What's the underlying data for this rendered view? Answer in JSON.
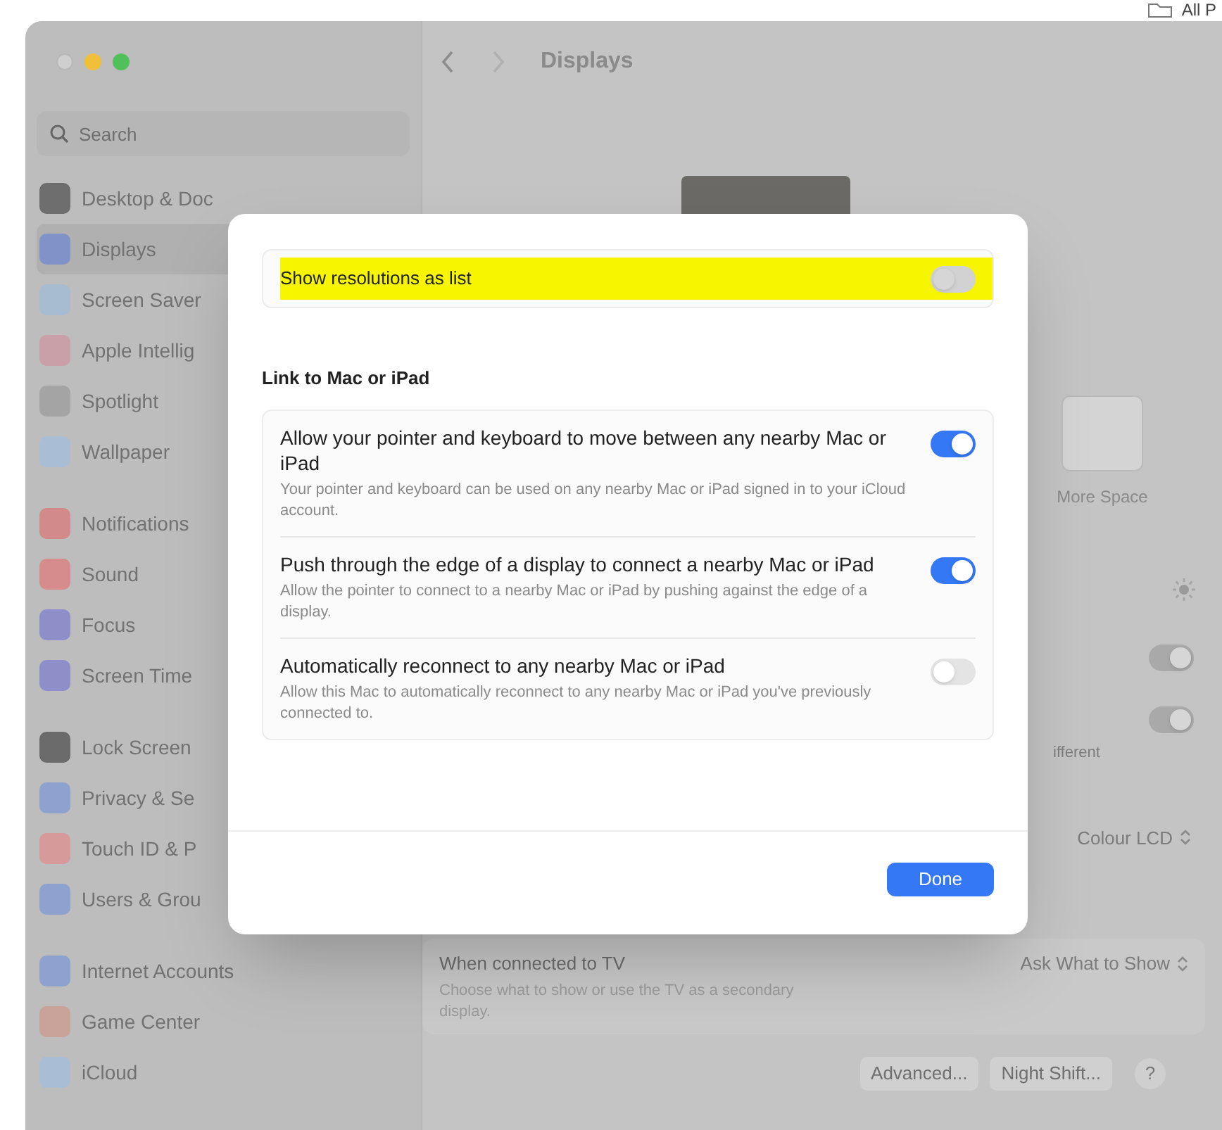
{
  "window": {
    "title": "Displays"
  },
  "top_right_label": "All P",
  "sidebar": {
    "search": {
      "placeholder": "Search"
    },
    "groups": [
      [
        {
          "label": "Desktop & Doc",
          "color": "#6e6e6e",
          "selected": false
        },
        {
          "label": "Displays",
          "color": "#7f93c8",
          "selected": true
        },
        {
          "label": "Screen Saver",
          "color": "#a7bcd0",
          "selected": false
        },
        {
          "label": "Apple Intellig",
          "color": "#c9a0a8",
          "selected": false
        },
        {
          "label": "Spotlight",
          "color": "#a4a4a4",
          "selected": false
        },
        {
          "label": "Wallpaper",
          "color": "#a9bdd4",
          "selected": false
        }
      ],
      [
        {
          "label": "Notifications",
          "color": "#d38a8a",
          "selected": false
        },
        {
          "label": "Sound",
          "color": "#d68c8c",
          "selected": false
        },
        {
          "label": "Focus",
          "color": "#8e8fc8",
          "selected": false
        },
        {
          "label": "Screen Time",
          "color": "#8e8fc8",
          "selected": false
        }
      ],
      [
        {
          "label": "Lock Screen",
          "color": "#6b6b6b",
          "selected": false
        },
        {
          "label": "Privacy & Se",
          "color": "#8ea2cf",
          "selected": false
        },
        {
          "label": "Touch ID & P",
          "color": "#d69a9a",
          "selected": false
        },
        {
          "label": "Users & Grou",
          "color": "#8ea2cf",
          "selected": false
        }
      ],
      [
        {
          "label": "Internet Accounts",
          "color": "#8ea2cf",
          "selected": false
        },
        {
          "label": "Game Center",
          "color": "#c9a39a",
          "selected": false
        },
        {
          "label": "iCloud",
          "color": "#a9bdd4",
          "selected": false
        }
      ]
    ]
  },
  "background": {
    "more_space_label": "More Space",
    "toggles": [
      {
        "on": true
      },
      {
        "on": true
      }
    ],
    "partial_label": "ifferent",
    "colour_popup": "Colour LCD",
    "tv_row": {
      "title": "When connected to TV",
      "subtitle": "Choose what to show or use the TV as a secondary display.",
      "value": "Ask What to Show"
    },
    "buttons": [
      "Advanced...",
      "Night Shift...",
      "?"
    ]
  },
  "dialog": {
    "top_setting": {
      "label": "Show resolutions as list",
      "on": false,
      "highlighted": true
    },
    "section_title": "Link to Mac or iPad",
    "settings": [
      {
        "title": "Allow your pointer and keyboard to move between any nearby Mac or iPad",
        "description": "Your pointer and keyboard can be used on any nearby Mac or iPad signed in to your iCloud account.",
        "on": true
      },
      {
        "title": "Push through the edge of a display to connect a nearby Mac or iPad",
        "description": "Allow the pointer to connect to a nearby Mac or iPad by pushing against the edge of a display.",
        "on": true
      },
      {
        "title": "Automatically reconnect to any nearby Mac or iPad",
        "description": "Allow this Mac to automatically reconnect to any nearby Mac or iPad you've previously connected to.",
        "on": false
      }
    ],
    "done_button": "Done"
  }
}
